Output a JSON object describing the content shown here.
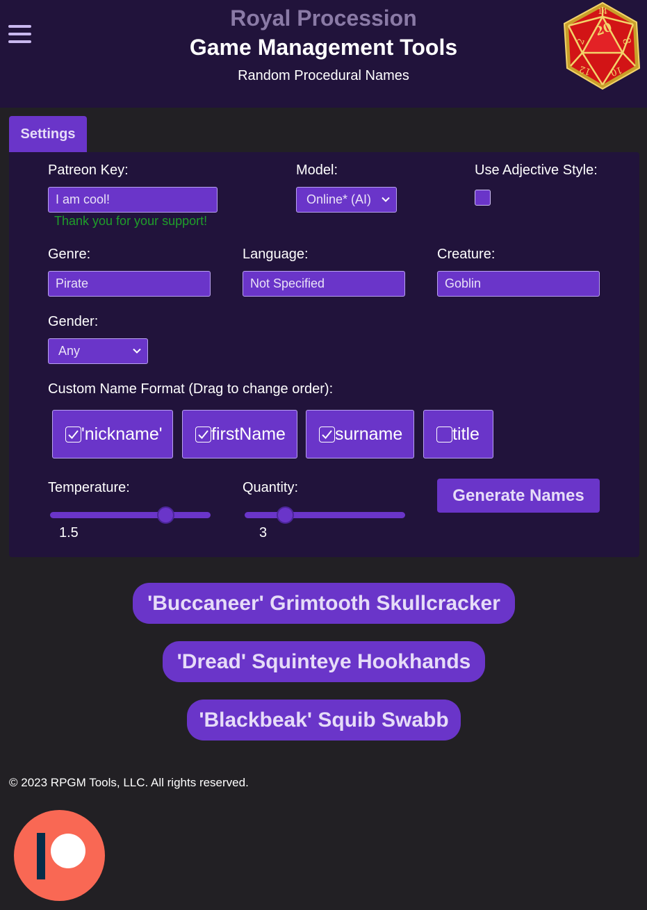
{
  "header": {
    "brand": "Royal Procession",
    "title": "Game Management Tools",
    "subtitle": "Random Procedural Names",
    "menu_icon": "hamburger-icon",
    "logo_icon": "d20-dice-icon"
  },
  "tabs": [
    {
      "label": "Settings"
    }
  ],
  "settings": {
    "patreon_key": {
      "label": "Patreon Key:",
      "value": "I am cool!",
      "status": "Thank you for your support!"
    },
    "model": {
      "label": "Model:",
      "selected": "Online* (AI)"
    },
    "adjective": {
      "label": "Use Adjective Style:",
      "checked": false
    },
    "genre": {
      "label": "Genre:",
      "value": "Pirate"
    },
    "language": {
      "label": "Language:",
      "value": "Not Specified"
    },
    "creature": {
      "label": "Creature:",
      "value": "Goblin"
    },
    "gender": {
      "label": "Gender:",
      "selected": "Any"
    },
    "format": {
      "label": "Custom Name Format (Drag to change order):",
      "items": [
        {
          "label": "'nickname'",
          "checked": true
        },
        {
          "label": "firstName",
          "checked": true
        },
        {
          "label": "surname",
          "checked": true
        },
        {
          "label": "title",
          "checked": false
        }
      ]
    },
    "temperature": {
      "label": "Temperature:",
      "value": "1.5",
      "fraction": 0.72
    },
    "quantity": {
      "label": "Quantity:",
      "value": "3",
      "fraction": 0.25
    },
    "generate_label": "Generate Names"
  },
  "results": [
    "'Buccaneer' Grimtooth Skullcracker",
    "'Dread' Squinteye Hookhands",
    "'Blackbeak' Squib Swabb"
  ],
  "footer": {
    "copyright": "© 2023 RPGM Tools, LLC. All rights reserved.",
    "patreon_icon": "patreon-icon"
  },
  "colors": {
    "accent": "#6a35c9",
    "header_bg": "#21133b",
    "page_bg": "#222024",
    "success": "#1f9e2a"
  }
}
